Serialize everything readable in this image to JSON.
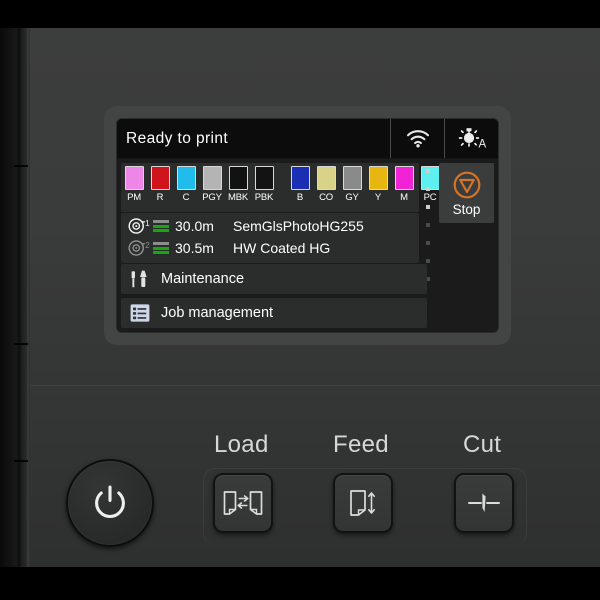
{
  "device": {
    "name": "large-format-printer-control-panel"
  },
  "screen": {
    "status_bar": {
      "message": "Ready to print",
      "wifi_icon": "wifi-icon",
      "lamp_icon": "lamp-auto-icon",
      "lamp_auto_letter": "A"
    },
    "ink_panel": {
      "label": "ink-tank-status",
      "group_left": [
        {
          "code": "PM",
          "color": "#ee86e8"
        },
        {
          "code": "R",
          "color": "#d0141b"
        },
        {
          "code": "C",
          "color": "#1fbced"
        },
        {
          "code": "PGY",
          "color": "#b4b4b4"
        },
        {
          "code": "MBK",
          "color": "#121212"
        },
        {
          "code": "PBK",
          "color": "#131313"
        }
      ],
      "group_right": [
        {
          "code": "B",
          "color": "#1b2fb4"
        },
        {
          "code": "CO",
          "color": "#d9d38a"
        },
        {
          "code": "GY",
          "color": "#8a8a8a"
        },
        {
          "code": "Y",
          "color": "#e8b610"
        },
        {
          "code": "M",
          "color": "#f024d6"
        },
        {
          "code": "PC",
          "color": "#5ef0ef"
        }
      ]
    },
    "stop_button": {
      "label": "Stop",
      "icon": "stop-sign-icon",
      "accent_color": "#d4742a"
    },
    "media_rows": [
      {
        "roll_icon": "paper-roll-icon",
        "roll_number": "1",
        "remaining": "30.0m",
        "media_name": "SemGlsPhotoHG255",
        "gauge_bars": [
          "gray",
          "green",
          "green"
        ]
      },
      {
        "roll_icon": "paper-roll-icon",
        "roll_number": "2",
        "remaining": "30.5m",
        "media_name": "HW Coated HG",
        "gauge_bars": [
          "gray",
          "green",
          "green"
        ]
      }
    ],
    "menu_rows": [
      {
        "icon": "maintenance-tools-icon",
        "label": "Maintenance"
      },
      {
        "icon": "job-list-icon",
        "label": "Job management"
      }
    ],
    "scroll_dots": {
      "total": 7,
      "active": 3
    }
  },
  "controls": {
    "power_button": {
      "icon": "power-icon"
    },
    "buttons": [
      {
        "label": "Load",
        "icon": "paper-load-icon"
      },
      {
        "label": "Feed",
        "icon": "paper-feed-icon"
      },
      {
        "label": "Cut",
        "icon": "paper-cut-icon"
      }
    ]
  }
}
